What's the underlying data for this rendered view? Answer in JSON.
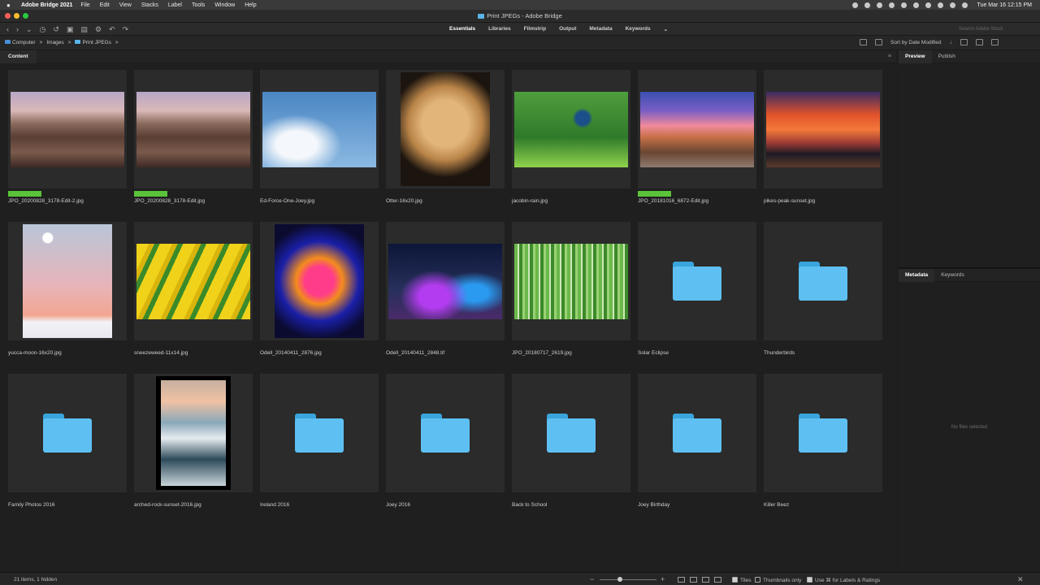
{
  "menubar": {
    "app_name": "Adobe Bridge 2021",
    "items": [
      "File",
      "Edit",
      "View",
      "Stacks",
      "Label",
      "Tools",
      "Window",
      "Help"
    ],
    "clock": "Tue Mar 16  12:15 PM"
  },
  "window": {
    "title": "Print JPEGs - Adobe Bridge"
  },
  "toolbar": {
    "workspaces": [
      "Essentials",
      "Libraries",
      "Filmstrip",
      "Output",
      "Metadata",
      "Keywords"
    ],
    "active_workspace": "Essentials",
    "search_placeholder": "Search Adobe Stock"
  },
  "path": {
    "crumbs": [
      "Computer",
      "Images",
      "Print JPEGs"
    ],
    "separator": ">",
    "sort_label": "Sort by Date Modified"
  },
  "content": {
    "tab_label": "Content",
    "items": [
      {
        "name": "JPO_20200828_3178-Edit-2.jpg",
        "kind": "landscape",
        "label_color": "#5bc339",
        "scene": "desert-dusk"
      },
      {
        "name": "JPO_20200828_3178-Edit.jpg",
        "kind": "landscape",
        "label_color": "#5bc339",
        "scene": "desert-dusk"
      },
      {
        "name": "Ed-Force-One-Joey.jpg",
        "kind": "landscape",
        "label_color": "",
        "scene": "airplane-sky"
      },
      {
        "name": "Otter-16x20.jpg",
        "kind": "portrait",
        "label_color": "",
        "scene": "golden-dog"
      },
      {
        "name": "jacobin-rain.jpg",
        "kind": "landscape",
        "label_color": "",
        "scene": "hummingbird-green"
      },
      {
        "name": "JPO_20181016_6872-Edit.jpg",
        "kind": "landscape",
        "label_color": "#5bc339",
        "scene": "badlands-sunset"
      },
      {
        "name": "pikes-peak-sunset.jpg",
        "kind": "landscape",
        "label_color": "",
        "scene": "fiery-sky"
      },
      {
        "name": "yucca-moon-16x20.jpg",
        "kind": "portrait",
        "label_color": "",
        "scene": "yucca-pastel"
      },
      {
        "name": "sneezeweed-11x14.jpg",
        "kind": "landscape",
        "label_color": "",
        "scene": "yellow-petals"
      },
      {
        "name": "Odell_20140411_2876.jpg",
        "kind": "portrait",
        "label_color": "",
        "scene": "neon-sign"
      },
      {
        "name": "Odell_20140411_2848.tif",
        "kind": "landscape",
        "label_color": "",
        "scene": "neon-night"
      },
      {
        "name": "JPO_20180717_2619.jpg",
        "kind": "landscape",
        "label_color": "",
        "scene": "green-blur"
      },
      {
        "name": "Solar Eclipse",
        "kind": "folder",
        "label_color": "",
        "scene": ""
      },
      {
        "name": "Thunderbirds",
        "kind": "folder",
        "label_color": "",
        "scene": ""
      },
      {
        "name": "Family Photos 2016",
        "kind": "folder",
        "label_color": "",
        "scene": ""
      },
      {
        "name": "arched-rock-sunset-2016.jpg",
        "kind": "framed",
        "label_color": "",
        "scene": "arch-ocean"
      },
      {
        "name": "Ireland 2016",
        "kind": "folder",
        "label_color": "",
        "scene": ""
      },
      {
        "name": "Joey 2016",
        "kind": "folder",
        "label_color": "",
        "scene": ""
      },
      {
        "name": "Back to School",
        "kind": "folder",
        "label_color": "",
        "scene": ""
      },
      {
        "name": "Joey Birthday",
        "kind": "folder",
        "label_color": "",
        "scene": ""
      },
      {
        "name": "Killer Beez",
        "kind": "folder",
        "label_color": "",
        "scene": ""
      }
    ]
  },
  "right_panel": {
    "top_tabs": [
      "Preview",
      "Publish"
    ],
    "bottom_tabs": [
      "Metadata",
      "Keywords"
    ],
    "empty_text": "No files selected"
  },
  "status": {
    "items_text": "21 items, 1 hidden",
    "tiles_label": "Tiles",
    "thumbs_only_label": "Thumbnails only",
    "labels_label": "Use ⌘ for Labels & Ratings",
    "zoom": 0.35
  },
  "colors": {
    "label_green": "#5bc339",
    "folder": "#5ec0f2",
    "background": "#1e1e1e"
  }
}
